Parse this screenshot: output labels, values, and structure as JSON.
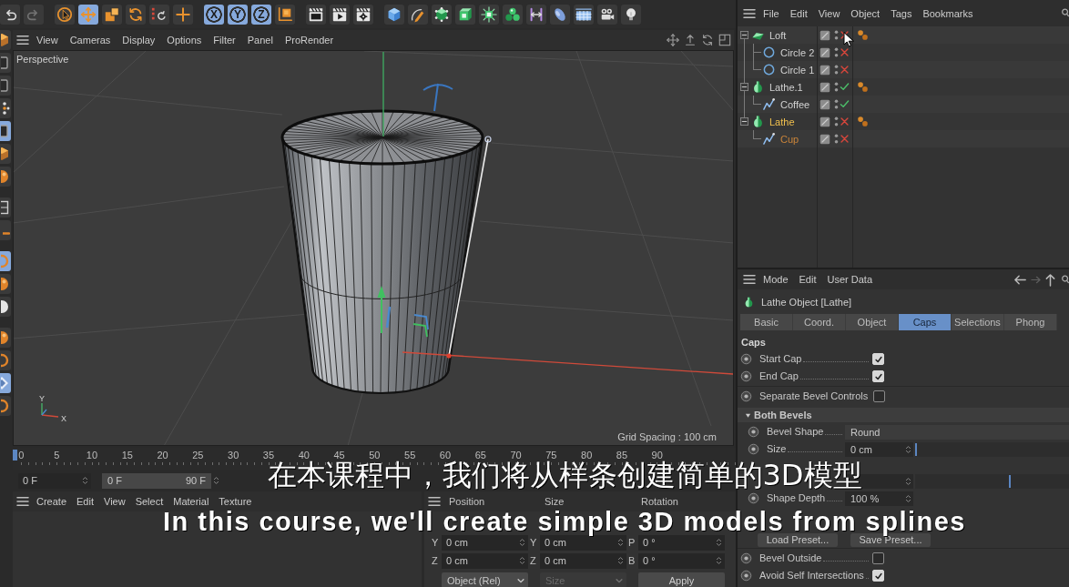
{
  "toolbar": [
    [
      {
        "kind": "undo",
        "disabled": false
      },
      {
        "kind": "redo",
        "disabled": true
      }
    ],
    [
      {
        "kind": "live-selection",
        "selected": false
      },
      {
        "kind": "move",
        "selected": true
      },
      {
        "kind": "scale",
        "selected": false
      },
      {
        "kind": "rotate",
        "selected": false
      },
      {
        "kind": "recent",
        "selected": false
      },
      {
        "kind": "add",
        "selected": false
      }
    ],
    [
      {
        "kind": "axis",
        "label": "X",
        "selected": true
      },
      {
        "kind": "axis",
        "label": "Y",
        "selected": true
      },
      {
        "kind": "axis",
        "label": "Z",
        "selected": true
      },
      {
        "kind": "coordinate-system",
        "selected": false
      }
    ],
    [
      {
        "kind": "render-view"
      },
      {
        "kind": "render-picture"
      },
      {
        "kind": "render-settings"
      }
    ],
    [
      {
        "kind": "cube"
      },
      {
        "kind": "pen"
      },
      {
        "kind": "subdivision"
      },
      {
        "kind": "extrude"
      },
      {
        "kind": "cloner"
      },
      {
        "kind": "clones"
      },
      {
        "kind": "bend"
      },
      {
        "kind": "field"
      },
      {
        "kind": "sky"
      },
      {
        "kind": "camera"
      },
      {
        "kind": "light"
      }
    ]
  ],
  "side_toolbar": [
    [
      {
        "kind": "cube",
        "selected": false
      },
      {
        "kind": "square",
        "selected": false
      },
      {
        "kind": "square",
        "selected": false
      },
      {
        "kind": "dots",
        "selected": false
      },
      {
        "kind": "square",
        "selected": true
      },
      {
        "kind": "cube",
        "selected": false
      },
      {
        "kind": "disc",
        "selected": false
      }
    ],
    [
      {
        "kind": "frame",
        "selected": false
      },
      {
        "kind": "dash",
        "selected": false
      }
    ],
    [
      {
        "kind": "ring",
        "selected": true
      },
      {
        "kind": "disc",
        "selected": false
      },
      {
        "kind": "sphere",
        "selected": false
      }
    ],
    [
      {
        "kind": "disc",
        "selected": false
      },
      {
        "kind": "ring",
        "selected": false
      },
      {
        "kind": "diamond",
        "selected": true
      },
      {
        "kind": "ring",
        "selected": false
      }
    ]
  ],
  "viewport": {
    "menu": [
      "View",
      "Cameras",
      "Display",
      "Options",
      "Filter",
      "Panel",
      "ProRender"
    ],
    "camera": "Perspective",
    "axis_labels": {
      "y": "Y",
      "x": "X"
    },
    "grid_spacing": "Grid Spacing : 100 cm"
  },
  "timeline": {
    "ticks": [
      {
        "label": "0",
        "selected": true
      },
      {
        "label": "5",
        "selected": false
      },
      {
        "label": "10",
        "selected": false
      },
      {
        "label": "15",
        "selected": false
      },
      {
        "label": "20",
        "selected": false
      },
      {
        "label": "25",
        "selected": false
      },
      {
        "label": "30",
        "selected": false
      },
      {
        "label": "35",
        "selected": false
      },
      {
        "label": "40",
        "selected": false
      },
      {
        "label": "45",
        "selected": false
      },
      {
        "label": "50",
        "selected": false
      },
      {
        "label": "55",
        "selected": false
      },
      {
        "label": "60",
        "selected": false
      },
      {
        "label": "65",
        "selected": false
      },
      {
        "label": "70",
        "selected": false
      },
      {
        "label": "75",
        "selected": false
      },
      {
        "label": "80",
        "selected": false
      },
      {
        "label": "85",
        "selected": false
      },
      {
        "label": "90",
        "selected": false
      }
    ],
    "current_frame": "0 F",
    "range": {
      "start": "0 F",
      "end": "90 F",
      "level": 1
    }
  },
  "material_manager": {
    "menu": [
      "Create",
      "Edit",
      "View",
      "Select",
      "Material",
      "Texture"
    ]
  },
  "coordinates": {
    "headers": [
      "Position",
      "Size",
      "Rotation"
    ],
    "rows": [
      [
        {
          "axis": "Y",
          "value": "0 cm"
        },
        {
          "axis": "Y",
          "value": "0 cm"
        },
        {
          "axis": "P",
          "value": "0 °"
        }
      ],
      [
        {
          "axis": "Z",
          "value": "0 cm"
        },
        {
          "axis": "Z",
          "value": "0 cm"
        },
        {
          "axis": "B",
          "value": "0 °"
        }
      ]
    ],
    "mode": "Object (Rel)",
    "size_mode": {
      "label": "Size",
      "disabled": true
    },
    "apply": "Apply"
  },
  "object_manager": {
    "menu": [
      "File",
      "Edit",
      "View",
      "Object",
      "Tags",
      "Bookmarks"
    ],
    "objects": [
      {
        "name": "Loft",
        "kind": "loft",
        "expanded": true,
        "enabled": false,
        "selected": false,
        "active": false,
        "tags": [
          {
            "kind": "phong"
          }
        ],
        "children": [
          {
            "name": "Circle 2",
            "kind": "circle",
            "enabled": false,
            "selected": false,
            "active": false
          },
          {
            "name": "Circle 1",
            "kind": "circle",
            "enabled": false,
            "selected": false,
            "active": false
          }
        ]
      },
      {
        "name": "Lathe.1",
        "kind": "lathe",
        "expanded": true,
        "enabled": true,
        "selected": false,
        "active": false,
        "tags": [
          {
            "kind": "phong"
          }
        ],
        "children": [
          {
            "name": "Coffee",
            "kind": "spline",
            "enabled": true,
            "selected": false,
            "active": false
          }
        ]
      },
      {
        "name": "Lathe",
        "kind": "lathe",
        "expanded": true,
        "enabled": false,
        "selected": true,
        "active": true,
        "tags": [
          {
            "kind": "phong"
          }
        ],
        "children": [
          {
            "name": "Cup",
            "kind": "spline",
            "enabled": false,
            "selected": true,
            "active": false
          }
        ]
      }
    ]
  },
  "attributes": {
    "menu": [
      "Mode",
      "Edit",
      "User Data"
    ],
    "title": "Lathe Object [Lathe]",
    "tabs": [
      {
        "label": "Basic",
        "selected": false
      },
      {
        "label": "Coord.",
        "selected": false
      },
      {
        "label": "Object",
        "selected": false
      },
      {
        "label": "Caps",
        "selected": true
      },
      {
        "label": "Selections",
        "selected": false
      },
      {
        "label": "Phong",
        "selected": false
      }
    ],
    "section": "Caps",
    "rows": [
      {
        "kind": "checkbox",
        "label": "Start Cap",
        "checked": true
      },
      {
        "kind": "checkbox",
        "label": "End Cap",
        "checked": true
      },
      {
        "kind": "divider"
      },
      {
        "kind": "checkbox",
        "label": "Separate Bevel Controls",
        "checked": false
      },
      {
        "kind": "group",
        "label": "Both Bevels",
        "expanded": true,
        "rows": [
          {
            "kind": "dropdown",
            "label": "Bevel Shape",
            "value": "Round"
          },
          {
            "kind": "slider",
            "label": "Size",
            "value": "0 cm",
            "level": 0
          },
          {
            "kind": "blank"
          },
          {
            "kind": "slider",
            "level": 0.61
          },
          {
            "kind": "number",
            "label": "Shape Depth",
            "value": "100 %"
          },
          {
            "kind": "blank"
          },
          {
            "kind": "buttons",
            "buttons": [
              "Load Preset...",
              "Save Preset..."
            ]
          }
        ]
      },
      {
        "kind": "divider"
      },
      {
        "kind": "checkbox",
        "label": "Bevel Outside",
        "checked": false
      },
      {
        "kind": "checkbox",
        "label": "Avoid Self Intersections",
        "checked": true
      }
    ]
  },
  "subtitles": [
    "在本课程中，我们将从样条创建简单的3D模型",
    "In this course, we'll create simple 3D models from splines"
  ]
}
